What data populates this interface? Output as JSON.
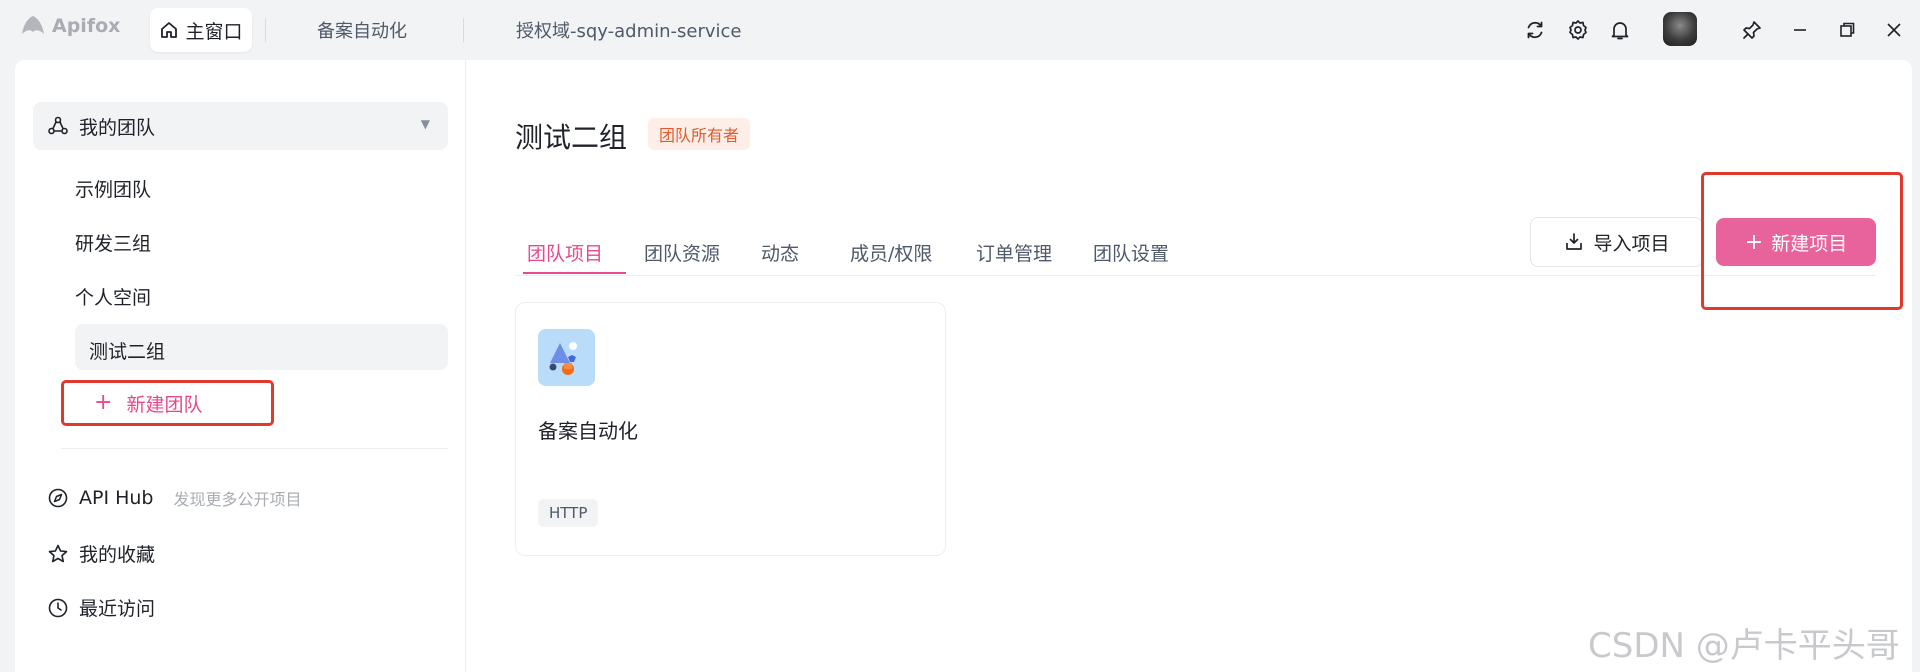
{
  "titlebar": {
    "app_name": "Apifox",
    "home_tab": "主窗口",
    "tabs": [
      "备案自动化",
      "授权域-sqy-admin-service"
    ]
  },
  "sidebar": {
    "team_select": "我的团队",
    "teams": [
      "示例团队",
      "研发三组",
      "个人空间",
      "测试二组"
    ],
    "new_team": "新建团队",
    "api_hub": {
      "label": "API Hub",
      "hint": "发现更多公开项目"
    },
    "favorites": "我的收藏",
    "recent": "最近访问"
  },
  "content": {
    "title": "测试二组",
    "badge": "团队所有者",
    "tabs": [
      "团队项目",
      "团队资源",
      "动态",
      "成员/权限",
      "订单管理",
      "团队设置"
    ],
    "active_tab": "团队项目",
    "import_button": "导入项目",
    "new_project_button": "新建项目",
    "projects": [
      {
        "name": "备案自动化",
        "tag": "HTTP"
      }
    ]
  },
  "watermark": "CSDN @卢卡平头哥",
  "colors": {
    "accent": "#e8498a",
    "highlight_box": "#e03a2e",
    "badge_text": "#e35b2f",
    "badge_bg": "#fdeee7"
  }
}
